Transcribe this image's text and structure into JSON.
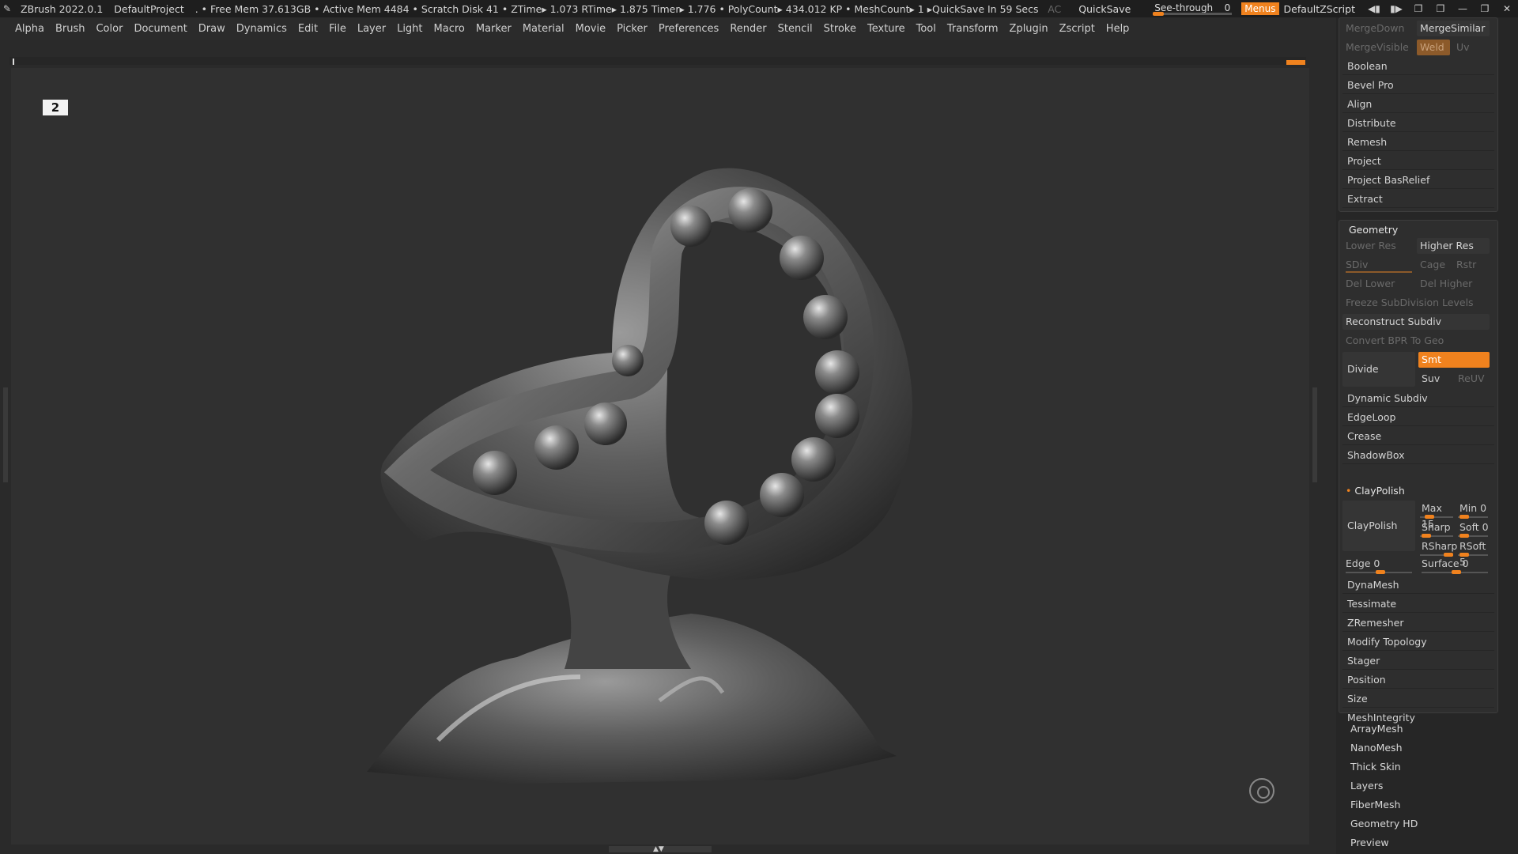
{
  "titlebar": {
    "app": "ZBrush 2022.0.1",
    "project": "DefaultProject",
    "status": ". • Free Mem 37.613GB • Active Mem 4484 • Scratch Disk 41 •  ZTime▸ 1.073 RTime▸ 1.875 Timer▸ 1.776 • PolyCount▸ 434.012 KP  • MeshCount▸ 1  ▸QuickSave In 59 Secs",
    "ac": "AC",
    "quicksave": "QuickSave",
    "see_through_label": "See-through",
    "see_through_value": "0",
    "see_through_level": 0,
    "menus": "Menus",
    "zscript": "DefaultZScript"
  },
  "menubar": {
    "items": [
      "Alpha",
      "Brush",
      "Color",
      "Document",
      "Draw",
      "Dynamics",
      "Edit",
      "File",
      "Layer",
      "Light",
      "Macro",
      "Marker",
      "Material",
      "Movie",
      "Picker",
      "Preferences",
      "Render",
      "Stencil",
      "Stroke",
      "Texture",
      "Tool",
      "Transform",
      "Zplugin",
      "Zscript",
      "Help"
    ]
  },
  "canvas": {
    "badge": "2",
    "accent": "#f0821e"
  },
  "panel": {
    "merge_down": "MergeDown",
    "merge_similar": "MergeSimilar",
    "merge_visible": "MergeVisible",
    "weld": "Weld",
    "uv": "Uv",
    "subtool_items": [
      "Boolean",
      "Bevel Pro",
      "Align",
      "Distribute",
      "Remesh",
      "Project",
      "Project BasRelief",
      "Extract"
    ],
    "geometry": {
      "title": "Geometry",
      "lower_res": "Lower Res",
      "higher_res": "Higher Res",
      "sdiv": "SDiv",
      "cage": "Cage",
      "rstr": "Rstr",
      "del_lower": "Del Lower",
      "del_higher": "Del Higher",
      "freeze": "Freeze SubDivision Levels",
      "reconstruct": "Reconstruct Subdiv",
      "convert_bpr": "Convert BPR To Geo",
      "divide": "Divide",
      "smt": "Smt",
      "suv": "Suv",
      "reuv": "ReUV",
      "items_a": [
        "Dynamic Subdiv",
        "EdgeLoop",
        "Crease",
        "ShadowBox"
      ],
      "claypolish_header": "ClayPolish",
      "claypolish_btn": "ClayPolish",
      "max": "Max 15",
      "min": "Min 0",
      "sharp": "Sharp",
      "soft": "Soft 0",
      "rsharp": "RSharp",
      "rsoft": "RSoft 5",
      "edge": "Edge 0",
      "surface": "Surface 0",
      "items_b": [
        "DynaMesh",
        "Tessimate",
        "ZRemesher",
        "Modify Topology",
        "Stager",
        "Position",
        "Size",
        "MeshIntegrity"
      ]
    },
    "bottom_items": [
      "ArrayMesh",
      "NanoMesh",
      "Thick Skin",
      "Layers",
      "FiberMesh",
      "Geometry HD",
      "Preview"
    ]
  }
}
